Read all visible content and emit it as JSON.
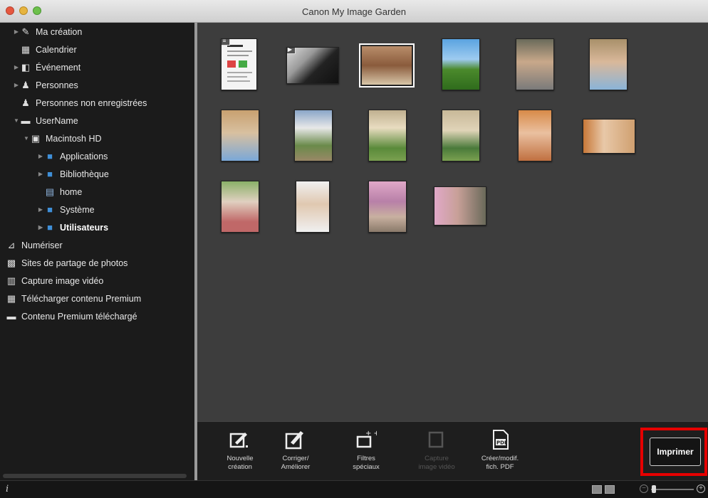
{
  "window": {
    "title": "Canon My Image Garden"
  },
  "sidebar": {
    "items": [
      {
        "label": "Ma création",
        "icon": "my-art-icon",
        "glyph": "✎",
        "expandable": true
      },
      {
        "label": "Calendrier",
        "icon": "calendar-icon",
        "glyph": "▦",
        "expandable": false
      },
      {
        "label": "Événement",
        "icon": "event-icon",
        "glyph": "◧",
        "expandable": true
      },
      {
        "label": "Personnes",
        "icon": "people-icon",
        "glyph": "♟",
        "expandable": true
      },
      {
        "label": "Personnes non enregistrées",
        "icon": "unregistered-people-icon",
        "glyph": "♟",
        "expandable": false
      },
      {
        "label": "UserName",
        "icon": "computer-icon",
        "glyph": "▬",
        "expandable": true
      },
      {
        "label": "Macintosh HD",
        "icon": "hard-drive-icon",
        "glyph": "▣",
        "expandable": true
      },
      {
        "label": "Applications",
        "icon": "folder-icon",
        "glyph": "■",
        "expandable": true
      },
      {
        "label": "Bibliothèque",
        "icon": "folder-icon",
        "glyph": "■",
        "expandable": true
      },
      {
        "label": "home",
        "icon": "home-folder-icon",
        "glyph": "▤",
        "expandable": false
      },
      {
        "label": "Système",
        "icon": "folder-icon",
        "glyph": "■",
        "expandable": true
      },
      {
        "label": "Utilisateurs",
        "icon": "folder-icon",
        "glyph": "■",
        "expandable": true
      },
      {
        "label": "Numériser",
        "icon": "scan-icon",
        "glyph": "⊿",
        "expandable": false
      },
      {
        "label": "Sites de partage de photos",
        "icon": "photo-sharing-icon",
        "glyph": "▩",
        "expandable": false
      },
      {
        "label": "Capture image vidéo",
        "icon": "video-capture-icon",
        "glyph": "▥",
        "expandable": false
      },
      {
        "label": "Télécharger contenu Premium",
        "icon": "download-premium-icon",
        "glyph": "▦",
        "expandable": false
      },
      {
        "label": "Contenu Premium téléchargé",
        "icon": "downloaded-premium-icon",
        "glyph": "▬",
        "expandable": false
      }
    ]
  },
  "toolbar": {
    "new_art": "Nouvelle\ncréation",
    "correct": "Corriger/\nAméliorer",
    "filters": "Filtres\nspéciaux",
    "video_capture": "Capture\nimage vidéo",
    "pdf": "Créer/modif.\nfich. PDF",
    "print": "Imprimer"
  },
  "statusbar": {
    "info": "i"
  },
  "colors": {
    "highlight": "#e60000",
    "background": "#3d3d3d",
    "sidebar": "#1b1b1b"
  }
}
